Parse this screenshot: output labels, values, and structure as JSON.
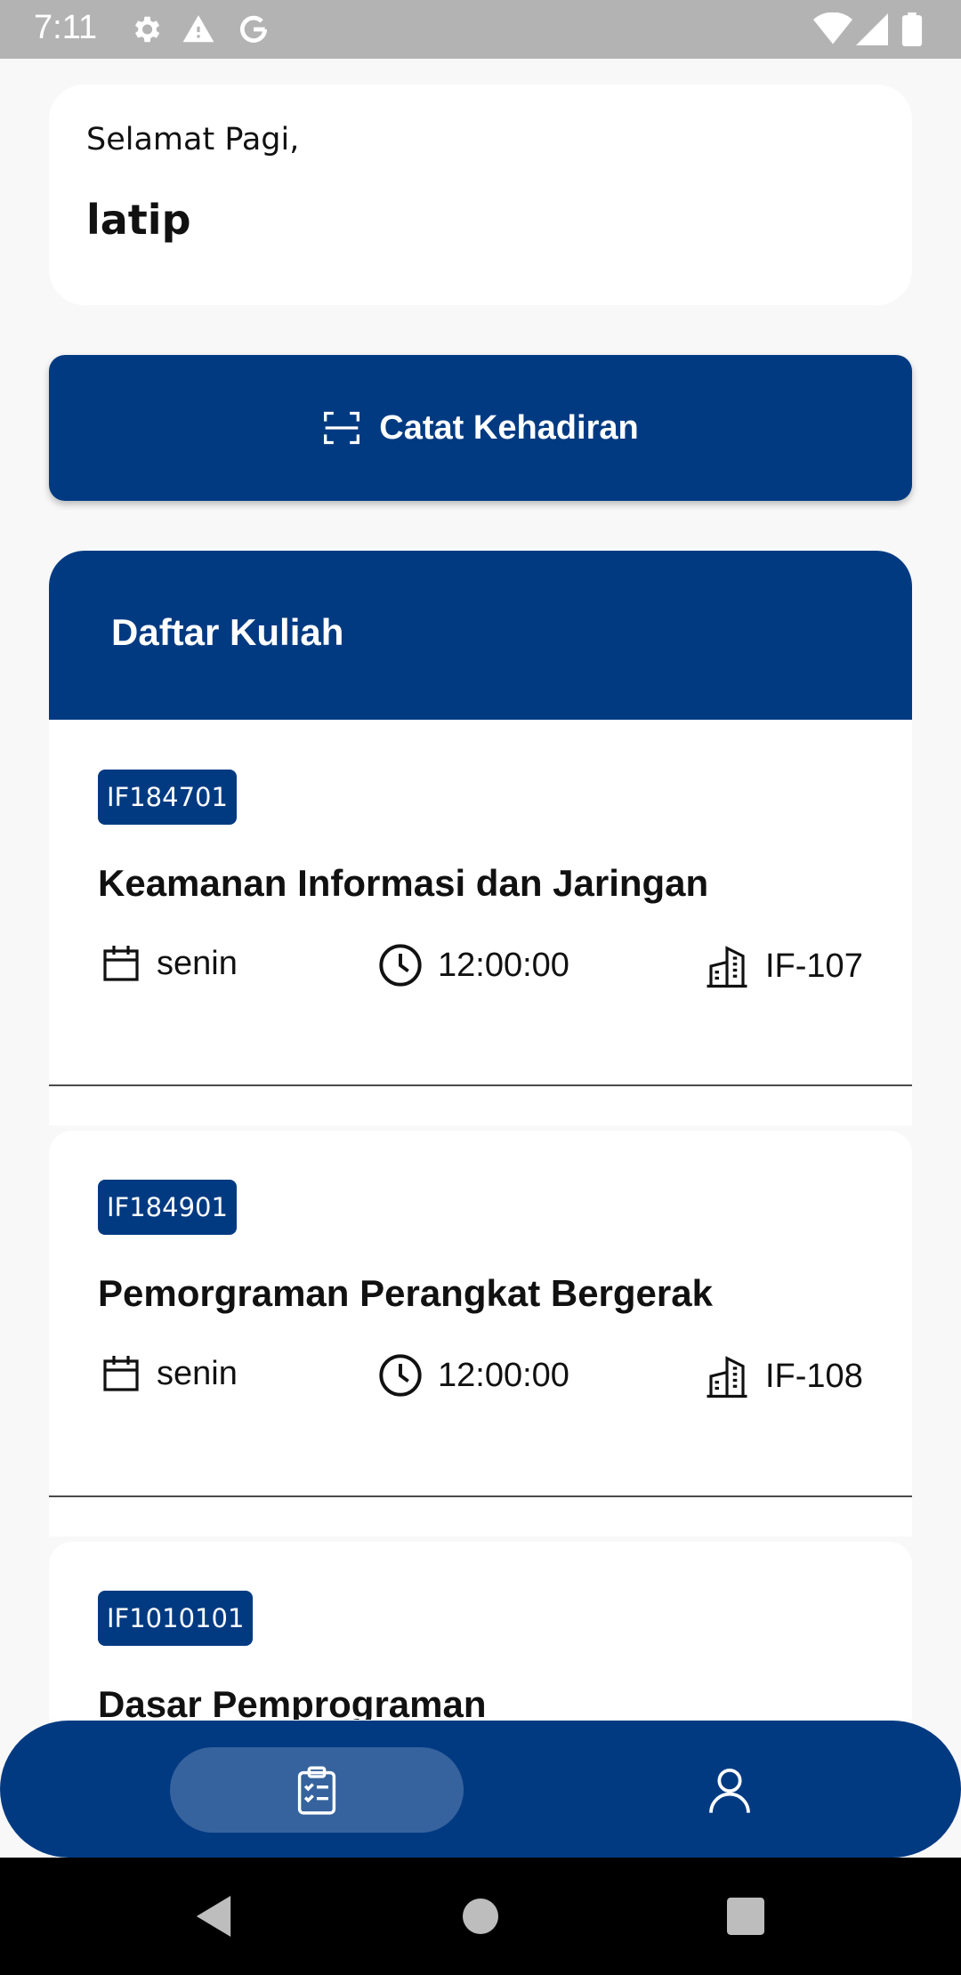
{
  "status_bar": {
    "time": "7:11",
    "icons_left": [
      "settings-icon",
      "warning-icon",
      "google-icon"
    ],
    "icons_right": [
      "wifi-icon",
      "signal-icon",
      "battery-icon"
    ]
  },
  "greeting": {
    "salutation": "Selamat Pagi,",
    "name": "latip"
  },
  "attendance_button": {
    "label": "Catat Kehadiran",
    "icon": "scan-icon"
  },
  "course_list": {
    "title": "Daftar Kuliah",
    "items": [
      {
        "code": "IF184701",
        "name": "Keamanan Informasi dan Jaringan",
        "day": "senin",
        "time": "12:00:00",
        "room": "IF-107"
      },
      {
        "code": "IF184901",
        "name": "Pemorgraman Perangkat Bergerak",
        "day": "senin",
        "time": "12:00:00",
        "room": "IF-108"
      },
      {
        "code": "IF1010101",
        "name": "Dasar Pemprograman"
      }
    ]
  },
  "bottom_nav": {
    "items": [
      {
        "name": "schedule",
        "icon": "clipboard-check-icon",
        "active": true
      },
      {
        "name": "profile",
        "icon": "user-icon",
        "active": false
      }
    ]
  },
  "colors": {
    "primary": "#023a82",
    "nav_active": "#36639e",
    "background": "#f8f8f9",
    "status_bar": "#b3b3b3"
  }
}
